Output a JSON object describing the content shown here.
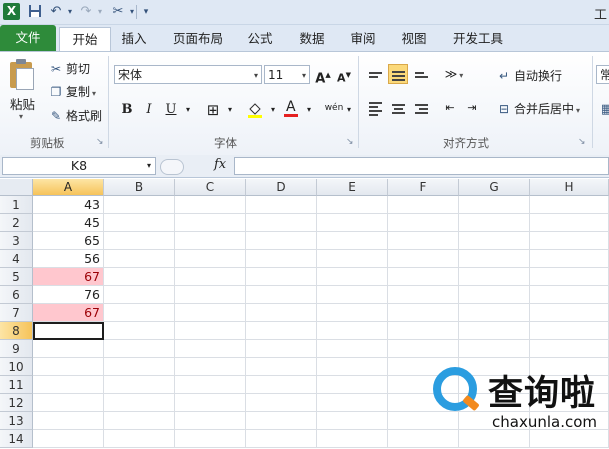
{
  "app": {
    "logo_letter": "X",
    "title_fragment": "工",
    "accent_color": "#2e8b3a"
  },
  "qat": {
    "icons": [
      "save-icon",
      "undo-icon",
      "dropdown-icon",
      "redo-icon",
      "dropdown-icon",
      "tools-icon",
      "customize-icon"
    ]
  },
  "tabs": {
    "file": "文件",
    "items": [
      "开始",
      "插入",
      "页面布局",
      "公式",
      "数据",
      "审阅",
      "视图",
      "开发工具"
    ],
    "active": "开始"
  },
  "ribbon": {
    "clipboard": {
      "label": "剪贴板",
      "paste": "粘贴",
      "cut": "剪切",
      "copy": "复制",
      "format_painter": "格式刷"
    },
    "font": {
      "label": "字体",
      "font_name": "宋体",
      "font_size": "11",
      "bold": "B",
      "italic": "I",
      "underline": "U",
      "grow": "A",
      "shrink": "A",
      "phonetic": "wén"
    },
    "alignment": {
      "label": "对齐方式",
      "wrap_text": "自动换行",
      "merge_center": "合并后居中"
    },
    "number": {
      "label_fragment": "常"
    }
  },
  "formula_bar": {
    "name_box": "K8",
    "fx": "fx",
    "formula": ""
  },
  "grid": {
    "columns": [
      "A",
      "B",
      "C",
      "D",
      "E",
      "F",
      "G",
      "H"
    ],
    "rows": [
      "1",
      "2",
      "3",
      "4",
      "5",
      "6",
      "7",
      "8",
      "9",
      "10",
      "11",
      "12",
      "13",
      "14"
    ],
    "active_row": "8",
    "active_column": "A",
    "column_a_values": [
      "43",
      "45",
      "65",
      "56",
      "67",
      "76",
      "67"
    ],
    "highlighted_rows": [
      "5",
      "7"
    ],
    "highlight_fill": "#ffc7ce",
    "highlight_text": "#9c0006"
  },
  "watermark": {
    "title": "查询啦",
    "url": "chaxunla.com"
  }
}
